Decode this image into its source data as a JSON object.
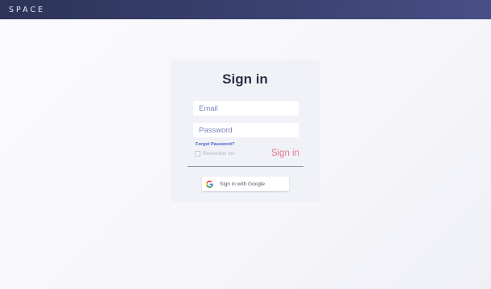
{
  "header": {
    "logo": "SPACE"
  },
  "signin": {
    "title": "Sign in",
    "email_placeholder": "Email",
    "password_placeholder": "Password",
    "forgot_link": "Forgot Password?",
    "remember_label": "Remember me",
    "submit_label": "Sign in",
    "google_label": "Sign in with Google"
  },
  "colors": {
    "header_start": "#2d3458",
    "header_end": "#474f86",
    "accent_pink": "#e1778f",
    "link_blue": "#4a64c7",
    "card_bg": "#f1f2f7"
  },
  "icons": {
    "google": "google-g-icon"
  }
}
